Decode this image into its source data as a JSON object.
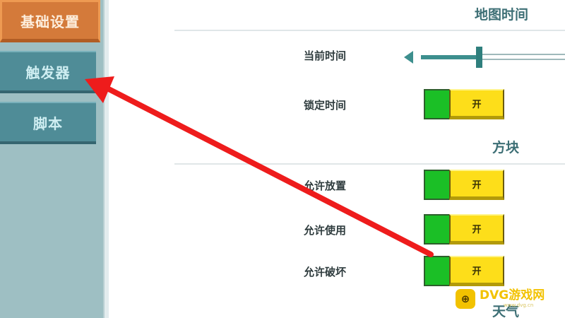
{
  "sidebar": {
    "items": [
      {
        "label": "基础设置",
        "active": true
      },
      {
        "label": "触发器",
        "active": false
      },
      {
        "label": "脚本",
        "active": false
      }
    ]
  },
  "sections": {
    "map_time": "地图时间",
    "blocks": "方块",
    "weather": "天气"
  },
  "rows": {
    "current_time": {
      "label": "当前时间",
      "slider_fraction": 0.38
    },
    "lock_time": {
      "label": "锁定时间",
      "toggle_text": "开",
      "on": true
    },
    "allow_place": {
      "label": "允许放置",
      "toggle_text": "开",
      "on": true
    },
    "allow_use": {
      "label": "允许使用",
      "toggle_text": "开",
      "on": true
    },
    "allow_break": {
      "label": "允许破坏",
      "toggle_text": "开",
      "on": true
    }
  },
  "annotation": {
    "color": "#ee1c1c",
    "icon": "arrow-pointing-at-trigger"
  },
  "watermark": {
    "brand": "DVG游戏网",
    "icon": "gamepad-icon",
    "sub": "www.dvg.cn"
  },
  "colors": {
    "active_tab": "#d47a3a",
    "tab": "#4f8c97",
    "toggle_green": "#1bbf26",
    "toggle_yellow": "#fdde1a",
    "slider": "#3d8f8e"
  }
}
